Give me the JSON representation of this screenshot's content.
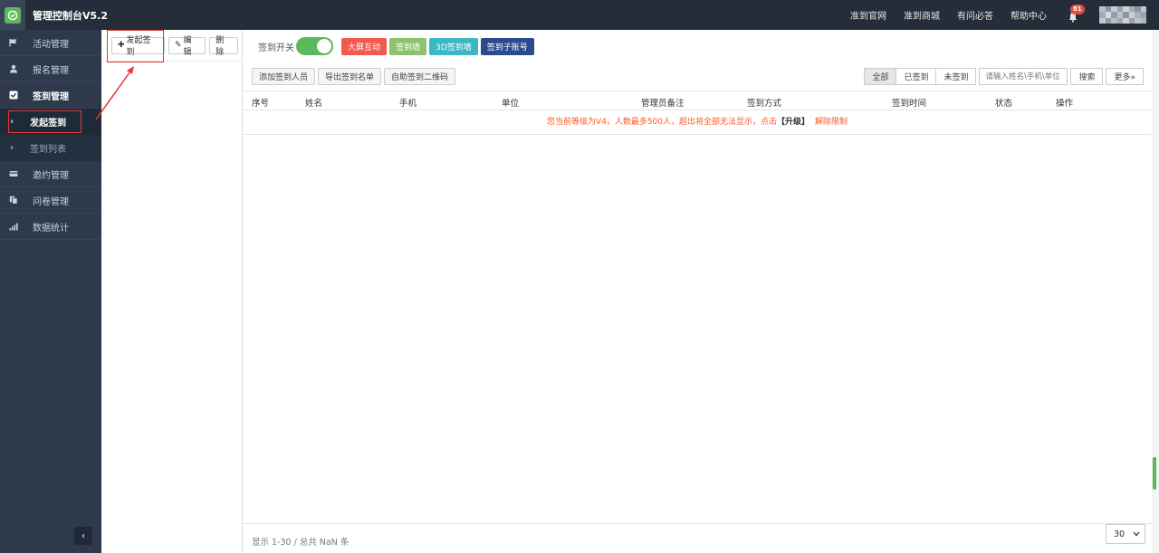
{
  "header": {
    "title": "管理控制台V5.2",
    "links": [
      "准到官网",
      "准到商城",
      "有问必答",
      "帮助中心"
    ],
    "notification_count": "81"
  },
  "sidebar": {
    "items": [
      {
        "label": "活动管理",
        "icon": "flag-icon"
      },
      {
        "label": "报名管理",
        "icon": "user-icon"
      },
      {
        "label": "签到管理",
        "icon": "checkbox-icon"
      },
      {
        "label": "发起签到",
        "sub": true
      },
      {
        "label": "签到列表",
        "sub": true
      },
      {
        "label": "邀约管理",
        "icon": "card-icon"
      },
      {
        "label": "问卷管理",
        "icon": "copy-icon"
      },
      {
        "label": "数据统计",
        "icon": "signal-icon"
      }
    ],
    "collapse_label": "‹"
  },
  "midpanel": {
    "start_label": "发起签到",
    "edit_label": "编辑",
    "delete_label": "删除"
  },
  "toolbar": {
    "switch_label": "签到开关",
    "big_screen_label": "大屏互动",
    "wall_label": "签到墙",
    "wall3d_label": "3D签到墙",
    "subaccount_label": "签到子账号",
    "add_person_label": "添加签到人员",
    "export_label": "导出签到名单",
    "qrcode_label": "自助签到二维码",
    "filter_all": "全部",
    "filter_signed": "已签到",
    "filter_unsigned": "未签到",
    "search_placeholder": "请输入姓名\\手机\\单位",
    "search_label": "搜索",
    "more_label": "更多»"
  },
  "table": {
    "columns": [
      "序号",
      "姓名",
      "手机",
      "单位",
      "管理员备注",
      "签到方式",
      "签到时间",
      "状态",
      "操作"
    ],
    "notice_text": "您当前等级为V4，人数最多500人，超出将全部无法显示，点击",
    "notice_upgrade": "【升级】",
    "notice_remove": "解除限制"
  },
  "footer": {
    "info": "显示 1-30 / 总共 NaN 条",
    "page_size": "30"
  },
  "colors": {
    "big_screen": "#f05a4f",
    "wall": "#8dc26f",
    "wall3d": "#3bb8c3",
    "subaccount": "#2a4c8c",
    "toggle": "#5cb85c"
  }
}
